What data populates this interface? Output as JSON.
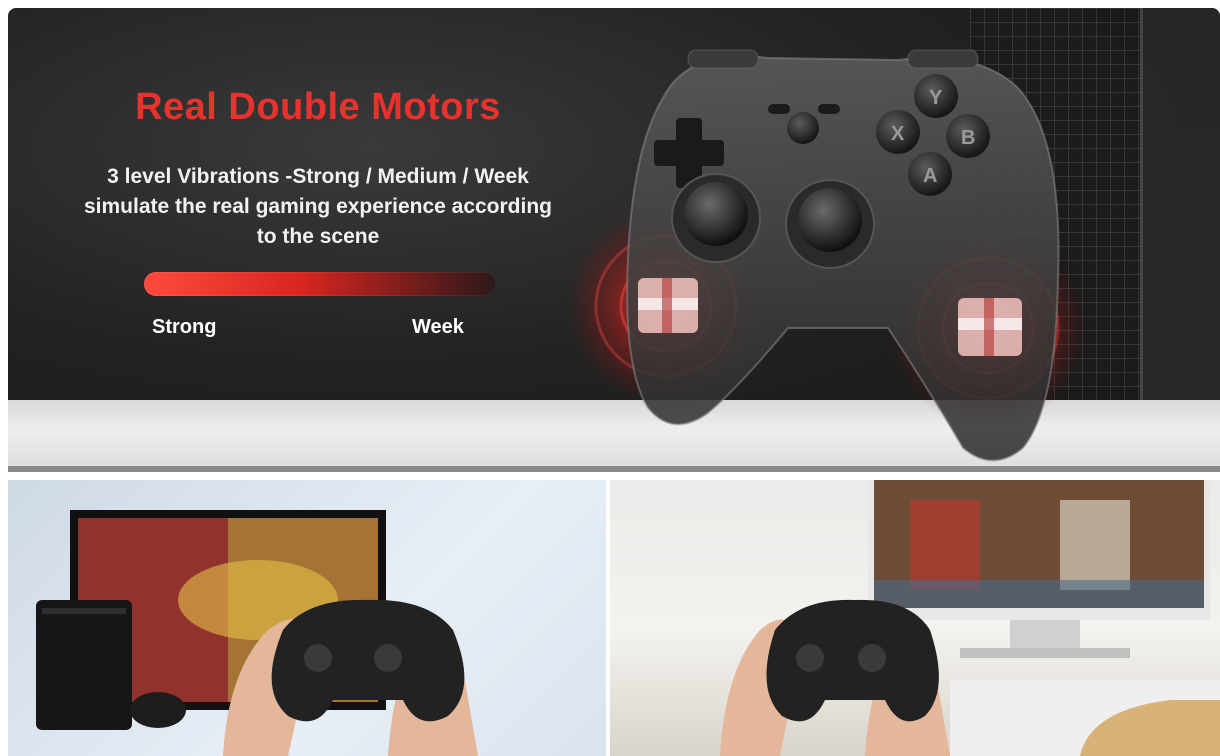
{
  "hero": {
    "title": "Real Double Motors",
    "description_lines": [
      "3 level Vibrations -Strong / Medium / Week",
      "simulate the real gaming experience according",
      "to the scene"
    ],
    "scale": {
      "left_label": "Strong",
      "right_label": "Week"
    },
    "controller_buttons": [
      "Y",
      "X",
      "B",
      "A"
    ]
  },
  "colors": {
    "title": "#e8322e",
    "vibration_glow": "#ff3a33"
  },
  "photos": {
    "left_scene": "controller-with-console-and-tv",
    "right_scene": "controller-with-monitor"
  }
}
